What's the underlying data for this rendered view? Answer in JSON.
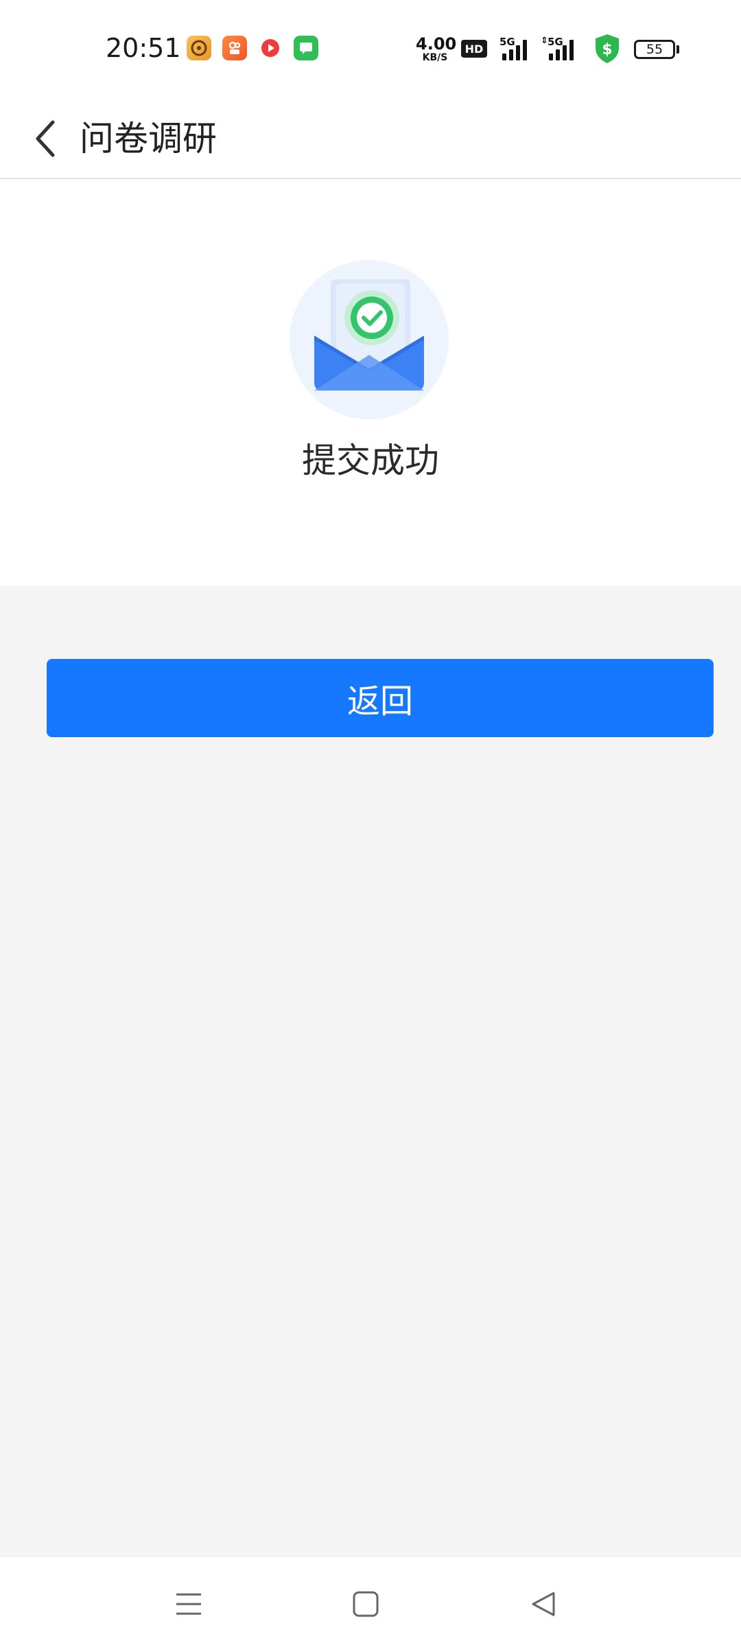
{
  "status_bar": {
    "time": "20:51",
    "net_speed_value": "4.00",
    "net_speed_unit": "KB/S",
    "hd_label": "HD",
    "signal_1_label": "5G",
    "signal_2_label": "5G",
    "battery_level": "55",
    "notification_icons": [
      "music-app-icon",
      "kuaishou-app-icon",
      "video-app-icon",
      "message-app-icon"
    ]
  },
  "header": {
    "back_icon": "chevron-left-icon",
    "title": "问卷调研"
  },
  "result": {
    "illustration_icon": "envelope-check-icon",
    "message": "提交成功"
  },
  "actions": {
    "return_label": "返回"
  },
  "system_nav": {
    "menu_icon": "menu-icon",
    "home_icon": "home-icon",
    "back_icon": "back-triangle-icon"
  },
  "colors": {
    "primary": "#1677ff",
    "success": "#34c46a",
    "envelope": "#3d82f5",
    "background": "#f4f4f5"
  }
}
